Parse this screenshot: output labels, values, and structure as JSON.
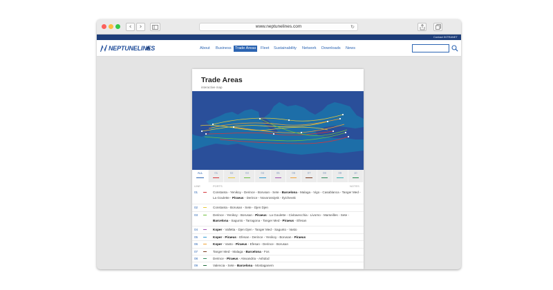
{
  "browser": {
    "url": "www.neptunelines.com"
  },
  "topbar": {
    "contact": "Contact",
    "intranet": "INTRANET"
  },
  "site": {
    "logo_text": "NEPTUNELINES",
    "nav": [
      "About",
      "Business",
      "Trade Areas",
      "Fleet",
      "Sustainability",
      "Network",
      "Downloads",
      "News"
    ],
    "active_nav": "Trade Areas"
  },
  "card": {
    "title": "Trade Areas",
    "subtitle": "interactive map"
  },
  "tabs": [
    {
      "label": "ALL",
      "color": "#2b64b2"
    },
    {
      "label": "01",
      "color": "#d6353a"
    },
    {
      "label": "02",
      "color": "#e6c93a"
    },
    {
      "label": "03",
      "color": "#6cbf3d"
    },
    {
      "label": "04",
      "color": "#2f9ad0"
    },
    {
      "label": "05",
      "color": "#a04fb0"
    },
    {
      "label": "06",
      "color": "#f0a033"
    },
    {
      "label": "07",
      "color": "#7a3a1e"
    },
    {
      "label": "08",
      "color": "#2f8a5a"
    },
    {
      "label": "09",
      "color": "#30b0b0"
    },
    {
      "label": "10",
      "color": "#1e8a4a"
    }
  ],
  "table": {
    "col_line": "LINE",
    "col_ports": "PORTS",
    "col_notes": "NOTES"
  },
  "rows": [
    {
      "code": "01",
      "color": "#d6353a",
      "ports": [
        [
          "Constanta",
          false
        ],
        [
          "Yenikoy",
          false
        ],
        [
          "Derince",
          false
        ],
        [
          "Borusan",
          false
        ],
        [
          "Sete",
          false
        ],
        [
          "Barcelona",
          true
        ],
        [
          "Malaga",
          false
        ],
        [
          "Vigo",
          false
        ],
        [
          "Casablanca",
          false
        ],
        [
          "Tanger Med",
          false
        ],
        [
          "La Goulette",
          false
        ],
        [
          "Piraeus",
          true
        ],
        [
          "Derince",
          false
        ],
        [
          "Novorossiysk",
          false
        ],
        [
          "Ilyichevsk",
          false
        ]
      ]
    },
    {
      "code": "02",
      "color": "#e6c93a",
      "ports": [
        [
          "Constanta",
          false
        ],
        [
          "Borusan",
          false
        ],
        [
          "Sete",
          false
        ],
        [
          "Djen Djen",
          false
        ]
      ]
    },
    {
      "code": "03",
      "color": "#6cbf3d",
      "ports": [
        [
          "Derince",
          false
        ],
        [
          "Yenikoy",
          false
        ],
        [
          "Borusan",
          false
        ],
        [
          "Piraeus",
          true
        ],
        [
          "La Goulette",
          false
        ],
        [
          "Civitavecchia",
          false
        ],
        [
          "Livorno",
          false
        ],
        [
          "Marseilles",
          false
        ],
        [
          "Sete",
          false
        ],
        [
          "Barcelona",
          true
        ],
        [
          "Sagunto",
          false
        ],
        [
          "Tarragona",
          false
        ],
        [
          "Tanger Med",
          false
        ],
        [
          "Piraeus",
          true
        ],
        [
          "Efesan",
          false
        ]
      ]
    },
    {
      "code": "04",
      "color": "#a04fb0",
      "ports": [
        [
          "Koper",
          true
        ],
        [
          "Valletta",
          false
        ],
        [
          "Djen Djen",
          false
        ],
        [
          "Tanger Med",
          false
        ],
        [
          "Sagunto",
          false
        ],
        [
          "Vasto",
          false
        ]
      ]
    },
    {
      "code": "05",
      "color": "#2f9ad0",
      "ports": [
        [
          "Koper",
          true
        ],
        [
          "Piraeus",
          true
        ],
        [
          "Efesan",
          false
        ],
        [
          "Derince",
          false
        ],
        [
          "Yenikoy",
          false
        ],
        [
          "Borusan",
          false
        ],
        [
          "Piraeus",
          true
        ]
      ]
    },
    {
      "code": "06",
      "color": "#f0a033",
      "ports": [
        [
          "Koper",
          true
        ],
        [
          "Vasto",
          false
        ],
        [
          "Piraeus",
          true
        ],
        [
          "Efesan",
          false
        ],
        [
          "Derince",
          false
        ],
        [
          "Borusan",
          false
        ]
      ]
    },
    {
      "code": "07",
      "color": "#7a3a1e",
      "ports": [
        [
          "Tanger Med",
          false
        ],
        [
          "Malaga",
          false
        ],
        [
          "Barcelona",
          true
        ],
        [
          "Fos",
          false
        ]
      ]
    },
    {
      "code": "08",
      "color": "#2f8a5a",
      "ports": [
        [
          "Derince",
          false
        ],
        [
          "Piraeus",
          true
        ],
        [
          "Alexandria",
          false
        ],
        [
          "Ashdod",
          false
        ]
      ]
    },
    {
      "code": "09",
      "color": "#1e6a3a",
      "ports": [
        [
          "Valencia",
          false
        ],
        [
          "Sete",
          false
        ],
        [
          "Barcelona",
          true
        ],
        [
          "Mostaganem",
          false
        ]
      ]
    }
  ]
}
